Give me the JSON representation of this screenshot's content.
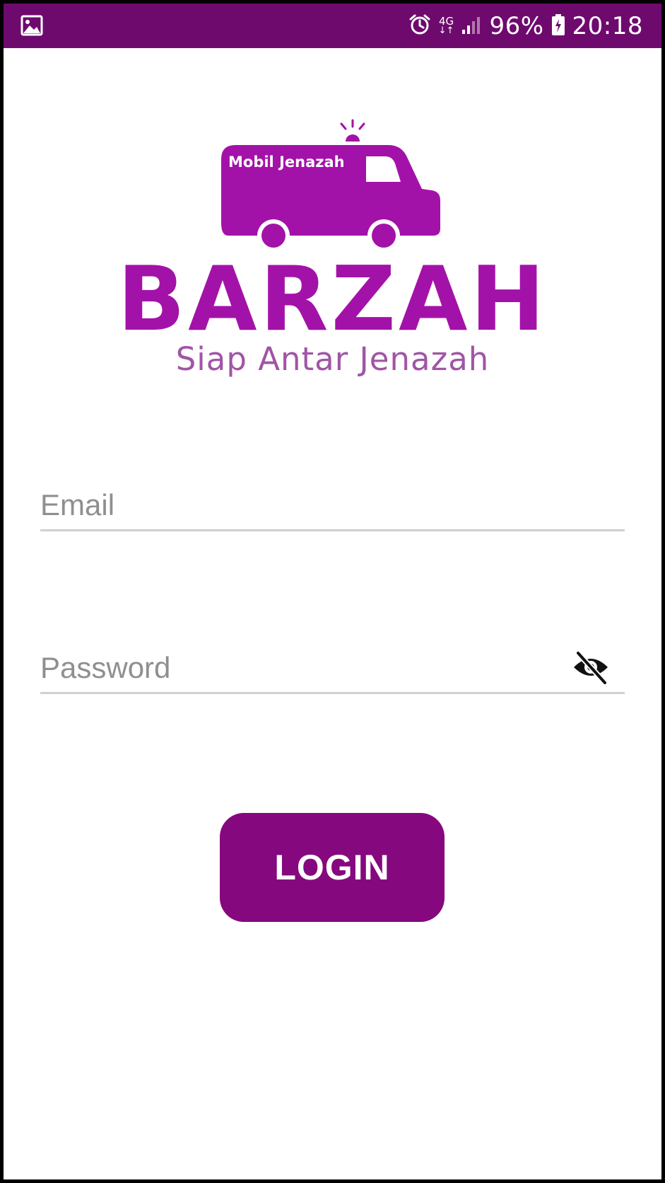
{
  "status_bar": {
    "network": "4G",
    "battery": "96%",
    "time": "20:18",
    "icons": [
      "image-notification-icon",
      "alarm-icon",
      "network-4g-icon",
      "signal-icon",
      "battery-charging-icon"
    ]
  },
  "logo": {
    "van_text": "Mobil Jenazah",
    "brand": "BARZAH",
    "tagline": "Siap Antar Jenazah"
  },
  "form": {
    "email_placeholder": "Email",
    "email_value": "",
    "password_placeholder": "Password",
    "password_value": "",
    "password_toggle_icon": "eye-off-icon",
    "login_label": "LOGIN"
  },
  "colors": {
    "status_bar": "#6e0a6e",
    "brand": "#a312a8",
    "tagline": "#a055a6",
    "button": "#86087f"
  }
}
